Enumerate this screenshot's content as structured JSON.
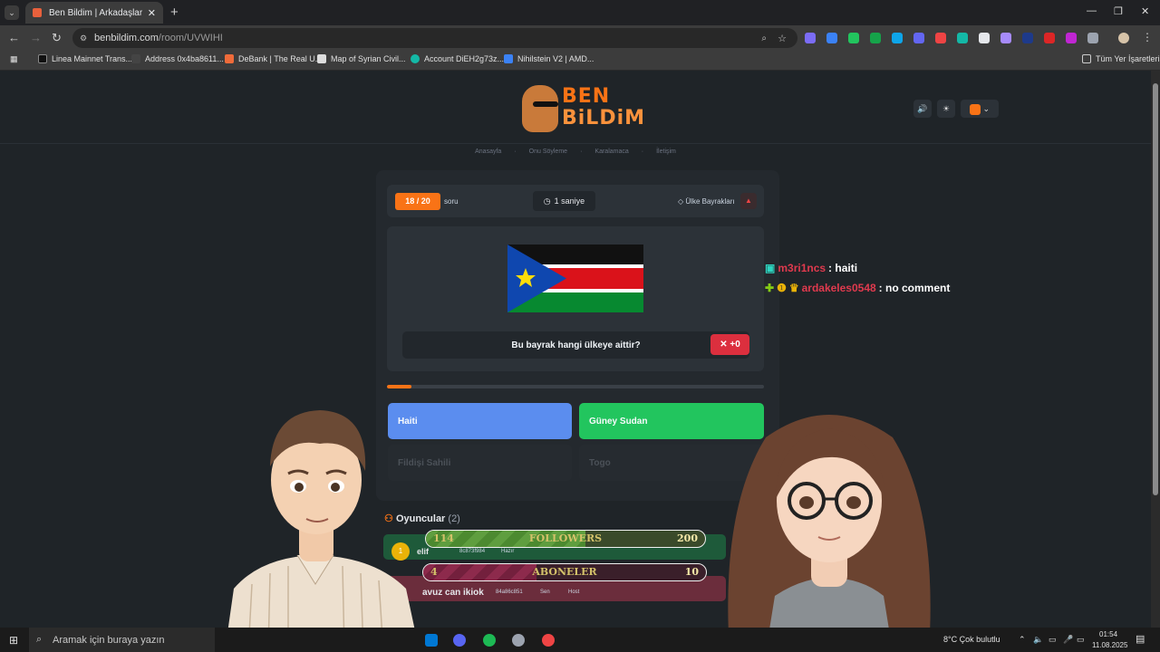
{
  "browser": {
    "tab_title": "Ben Bildim | Arkadaşlarınla Onli",
    "url_host": "benbildim.com",
    "url_path": "/room/UVWIHI",
    "bookmarks": [
      "Linea Mainnet Trans...",
      "Address 0x4ba8611...",
      "DeBank | The Real U...",
      "Map of Syrian Civil...",
      "Account DiEH2g73z...",
      "Nihilstein V2 | AMD..."
    ],
    "all_bookmarks": "Tüm Yer İşaretleri"
  },
  "header": {
    "logo_line1": "BEN",
    "logo_line2": "BiLDiM",
    "nav": [
      "Anasayfa",
      "Onu Söyleme",
      "Karalamaca",
      "İletişim"
    ]
  },
  "game": {
    "question_counter": "18 / 20",
    "question_word": "soru",
    "timer": "1 saniye",
    "category": "Ülke Bayrakları",
    "question": "Bu bayrak hangi ülkeye aittir?",
    "score": "+0",
    "progress": 0.065,
    "options": [
      {
        "label": "Haiti",
        "state": "wrong"
      },
      {
        "label": "Güney Sudan",
        "state": "correct"
      },
      {
        "label": "Fildişi Sahili",
        "state": "disabled"
      },
      {
        "label": "Togo",
        "state": "disabled"
      }
    ]
  },
  "players": {
    "title": "Oyuncular",
    "count": "(2)",
    "list": [
      {
        "rank": "1",
        "name": "elif",
        "id": "8c873f984",
        "status": "Hazır"
      },
      {
        "name": "avuz can ikiok",
        "id": "84a86c851",
        "tag1": "Sen",
        "tag2": "Host"
      }
    ]
  },
  "overlay": {
    "followers_label": "FOLLOWERS",
    "followers_current": "114",
    "followers_goal": "200",
    "followers_progress": 0.57,
    "subs_label": "ABONELER",
    "subs_current": "4",
    "subs_goal": "10",
    "subs_progress": 0.4
  },
  "chat": [
    {
      "user": "m3ri1ncs",
      "message": ": haiti"
    },
    {
      "user": "ardakeles0548",
      "message": ": no comment"
    }
  ],
  "taskbar": {
    "search_placeholder": "Aramak için buraya yazın",
    "weather": "8°C  Çok bulutlu",
    "time": "01:54",
    "date": "11.08.2025"
  },
  "colors": {
    "accent": "#f97316",
    "wrong": "#5b8def",
    "correct": "#22c55e",
    "score_bg": "#dc2f3e",
    "chat_user": "#e03a4e"
  }
}
